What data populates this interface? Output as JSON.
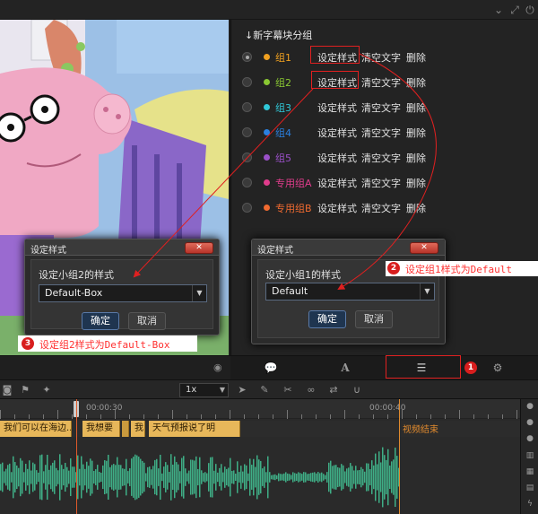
{
  "panel": {
    "title": "↓新字幕块分组",
    "groups": [
      {
        "name": "组1",
        "color": "#f0a020",
        "selected": true
      },
      {
        "name": "组2",
        "color": "#8ac832",
        "selected": false
      },
      {
        "name": "组3",
        "color": "#30c8d8",
        "selected": false
      },
      {
        "name": "组4",
        "color": "#2a80e0",
        "selected": false
      },
      {
        "name": "组5",
        "color": "#9a50c8",
        "selected": false
      },
      {
        "name": "专用组A",
        "color": "#e03c8c",
        "selected": false
      },
      {
        "name": "专用组B",
        "color": "#f06a30",
        "selected": false
      }
    ],
    "actions": {
      "set_style": "设定样式",
      "clear_text": "清空文字",
      "delete": "删除"
    }
  },
  "dialog_group2": {
    "title": "设定样式",
    "label": "设定小组2的样式",
    "value": "Default-Box",
    "ok": "确定",
    "cancel": "取消"
  },
  "dialog_group1": {
    "title": "设定样式",
    "label": "设定小组1的样式",
    "value": "Default",
    "ok": "确定",
    "cancel": "取消"
  },
  "annotations": {
    "step1": "1",
    "step2": {
      "num": "2",
      "text": "设定组1样式为Default"
    },
    "step3": {
      "num": "3",
      "text": "设定组2样式为Default-Box"
    }
  },
  "timeline": {
    "speed": "1x",
    "ticks": [
      "00:00:30",
      "00:00:40"
    ],
    "clips": [
      "我们可以在海边...",
      "我想要",
      "我",
      "天气预报说了明"
    ],
    "end_label": "视频结束"
  },
  "colors": {
    "accent_red": "#e02020",
    "clip": "#e7b75a",
    "wave": "#3fae86"
  },
  "icons": [
    "chevron-down-icon",
    "expand-icon",
    "power-icon",
    "eye-icon",
    "comment-icon",
    "font-icon",
    "list-icon",
    "gear-icon"
  ]
}
